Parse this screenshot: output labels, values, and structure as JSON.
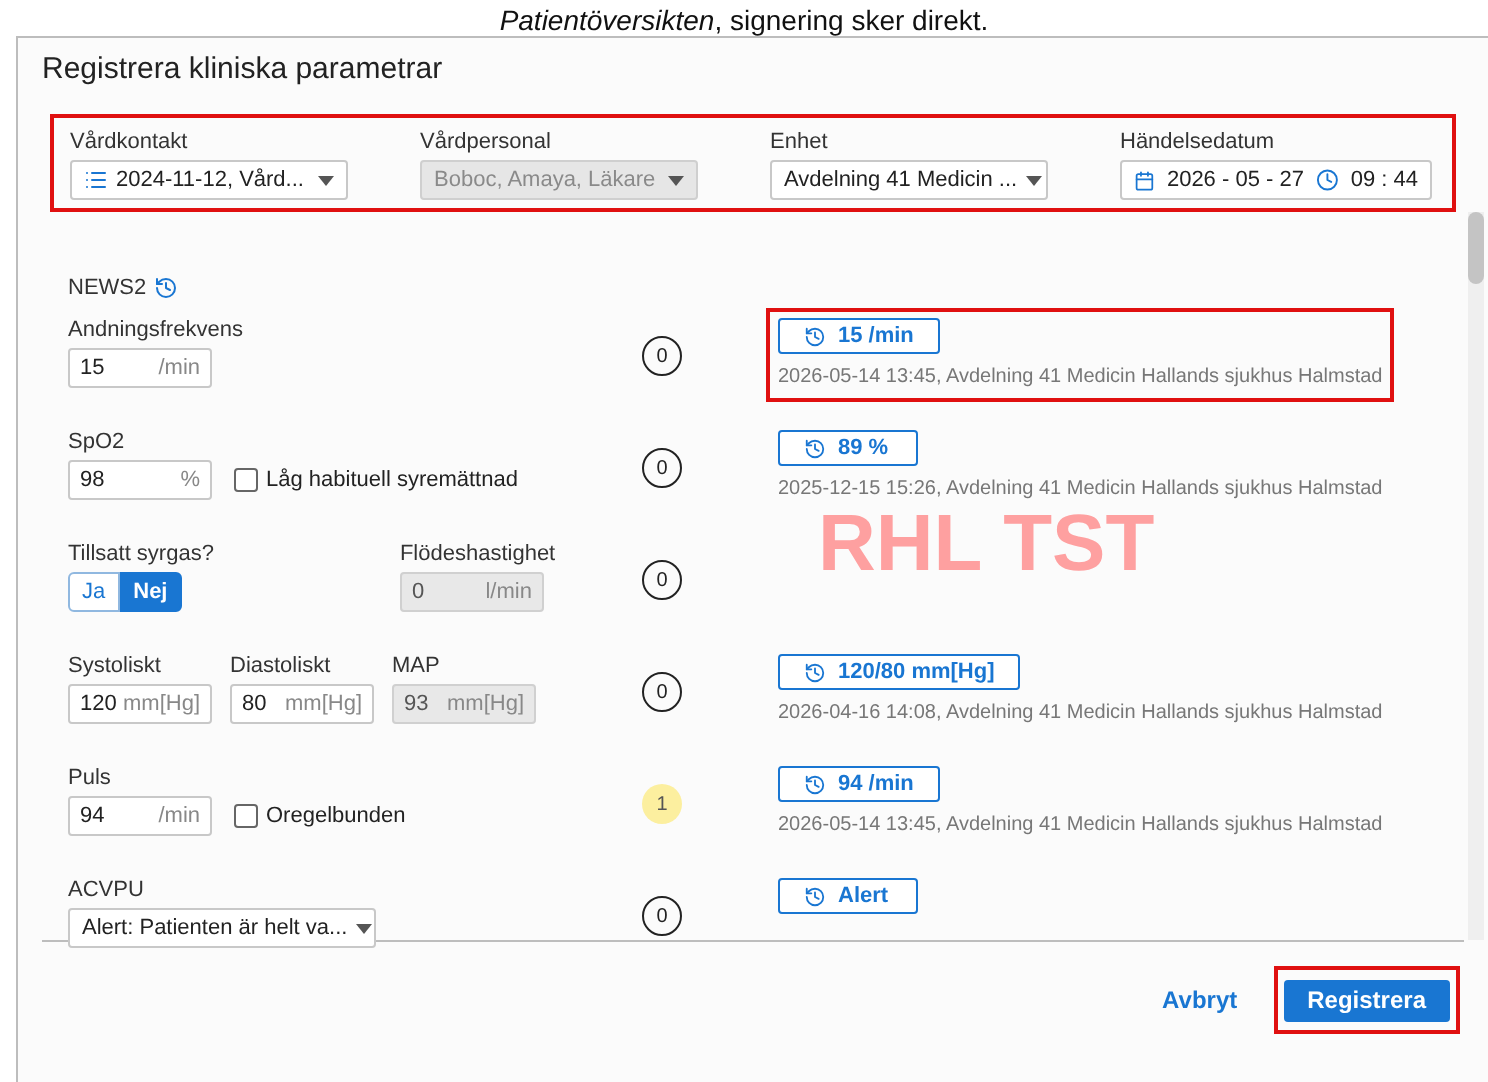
{
  "top_note": "*Patientöversikten*, signering sker direkt.",
  "dialog": {
    "title": "Registrera kliniska parametrar"
  },
  "header": {
    "highlighted": true,
    "fields": [
      {
        "kind": "select",
        "label": "Vårdkontakt",
        "value": "2024-11-12, Vård...",
        "disabled": false
      },
      {
        "kind": "select",
        "label": "Vårdpersonal",
        "value": "Boboc, Amaya, Läkare",
        "disabled": true
      },
      {
        "kind": "select",
        "label": "Enhet",
        "value": "Avdelning 41 Medicin ...",
        "disabled": false
      },
      {
        "kind": "datetime",
        "label": "Händelsedatum",
        "date": "2026 - 05 - 27",
        "time": "09 : 44"
      }
    ]
  },
  "section": {
    "title": "NEWS2"
  },
  "environment_label": "RHL TST",
  "rows": [
    {
      "fields": [
        {
          "kind": "input",
          "label": "Andningsfrekvens",
          "value": "15",
          "unit": "/min",
          "disabled": false
        }
      ],
      "score": "0",
      "score_raised": false,
      "history": {
        "value": "15 /min",
        "meta": "2026-05-14 13:45, Avdelning 41 Medicin Hallands sjukhus Halmstad",
        "highlighted": true
      }
    },
    {
      "fields": [
        {
          "kind": "input",
          "label": "SpO2",
          "value": "98",
          "unit": "%",
          "disabled": false
        }
      ],
      "checkbox": {
        "label": "Låg habituell syremättnad",
        "checked": false
      },
      "score": "0",
      "score_raised": false,
      "history": {
        "value": "89 %",
        "meta": "2025-12-15 15:26, Avdelning 41 Medicin Hallands sjukhus Halmstad",
        "highlighted": false
      }
    },
    {
      "fields": [
        {
          "kind": "toggle",
          "label": "Tillsatt syrgas?",
          "options": [
            {
              "label": "Ja",
              "selected": false
            },
            {
              "label": "Nej",
              "selected": true
            }
          ]
        },
        {
          "kind": "input",
          "label": "Flödeshastighet",
          "value": "0",
          "unit": "l/min",
          "disabled": true
        }
      ],
      "score": "0",
      "score_raised": false
    },
    {
      "fields": [
        {
          "kind": "input",
          "label": "Systoliskt",
          "value": "120",
          "unit": "mm[Hg]",
          "disabled": false
        },
        {
          "kind": "input",
          "label": "Diastoliskt",
          "value": "80",
          "unit": "mm[Hg]",
          "disabled": false
        },
        {
          "kind": "input",
          "label": "MAP",
          "value": "93",
          "unit": "mm[Hg]",
          "disabled": true
        }
      ],
      "score": "0",
      "score_raised": false,
      "history": {
        "value": "120/80 mm[Hg]",
        "meta": "2026-04-16 14:08, Avdelning 41 Medicin Hallands sjukhus Halmstad",
        "highlighted": false
      }
    },
    {
      "fields": [
        {
          "kind": "input",
          "label": "Puls",
          "value": "94",
          "unit": "/min",
          "disabled": false
        }
      ],
      "checkbox": {
        "label": "Oregelbunden",
        "checked": false
      },
      "score": "1",
      "score_raised": true,
      "history": {
        "value": "94 /min",
        "meta": "2026-05-14 13:45, Avdelning 41 Medicin Hallands sjukhus Halmstad",
        "highlighted": false
      }
    },
    {
      "fields": [
        {
          "kind": "select",
          "label": "ACVPU",
          "value": "Alert: Patienten är helt va...",
          "disabled": false
        }
      ],
      "score": "0",
      "score_raised": false,
      "history": {
        "value": "Alert",
        "highlighted": false
      }
    }
  ],
  "footer": {
    "cancel": "Avbryt",
    "submit": {
      "label": "Registrera",
      "highlighted": true
    }
  }
}
